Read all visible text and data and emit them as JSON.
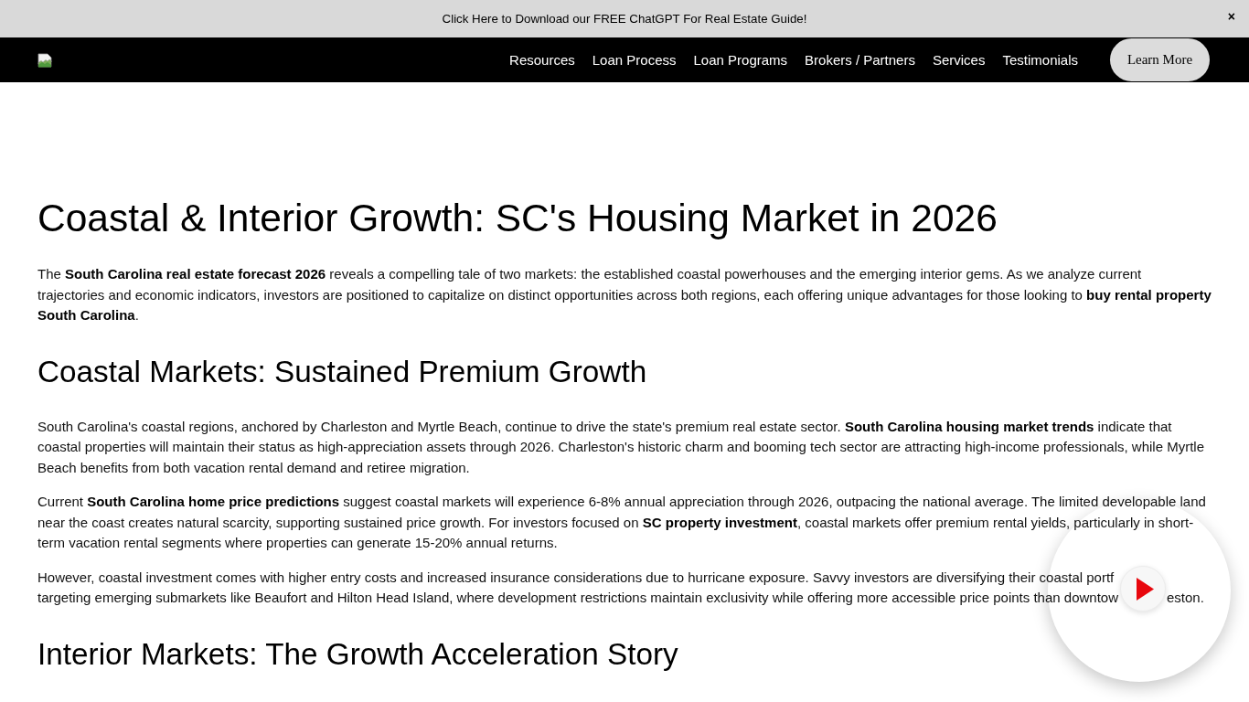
{
  "promo_bar": {
    "text": "Click Here to Download our FREE ChatGPT For Real Estate Guide!",
    "close": "×"
  },
  "navbar": {
    "links": [
      "Resources",
      "Loan Process",
      "Loan Programs",
      "Brokers / Partners",
      "Services",
      "Testimonials"
    ],
    "button": "Learn More"
  },
  "article": [
    {
      "kind": "title",
      "text": "Coastal & Interior Growth: SC's Housing Market in 2026"
    },
    {
      "kind": "paragraph",
      "text": "The **South Carolina real estate forecast 2026** reveals a compelling tale of two markets: the established coastal powerhouses and the emerging interior gems. As we analyze current trajectories and economic indicators, investors are positioned to capitalize on distinct opportunities across both regions, each offering unique advantages for those looking to **buy rental property South Carolina**."
    },
    {
      "kind": "heading",
      "text": "Coastal Markets: Sustained Premium Growth"
    },
    {
      "kind": "paragraph",
      "text": "South Carolina's coastal regions, anchored by Charleston and Myrtle Beach, continue to drive the state's premium real estate sector. **South Carolina housing market trends** indicate that coastal properties will maintain their status as high-appreciation assets through 2026. Charleston's historic charm and booming tech sector are attracting high-income professionals, while Myrtle Beach benefits from both vacation rental demand and retiree migration."
    },
    {
      "kind": "paragraph",
      "text": "Current **South Carolina home price predictions** suggest coastal markets will experience 6-8% annual appreciation through 2026, outpacing the national average. The limited developable land near the coast creates natural scarcity, supporting sustained price growth. For investors focused on **SC property investment**, coastal markets offer premium rental yields, particularly in short-term vacation rental segments where properties can generate 15-20% annual returns."
    },
    {
      "kind": "covered_paragraph",
      "parts": [
        "However, coastal investment comes with higher entry costs and increased insurance considerations due to hurricane exposure. Savvy investors are diversifying their coastal portf",
        "targeting emerging submarkets like Beaufort and Hilton Head Island, where development restrictions maintain exclusivity while offering more accessible price points than downtow",
        "eston."
      ]
    },
    {
      "kind": "heading",
      "text": "Interior Markets: The Growth Acceleration Story"
    }
  ]
}
